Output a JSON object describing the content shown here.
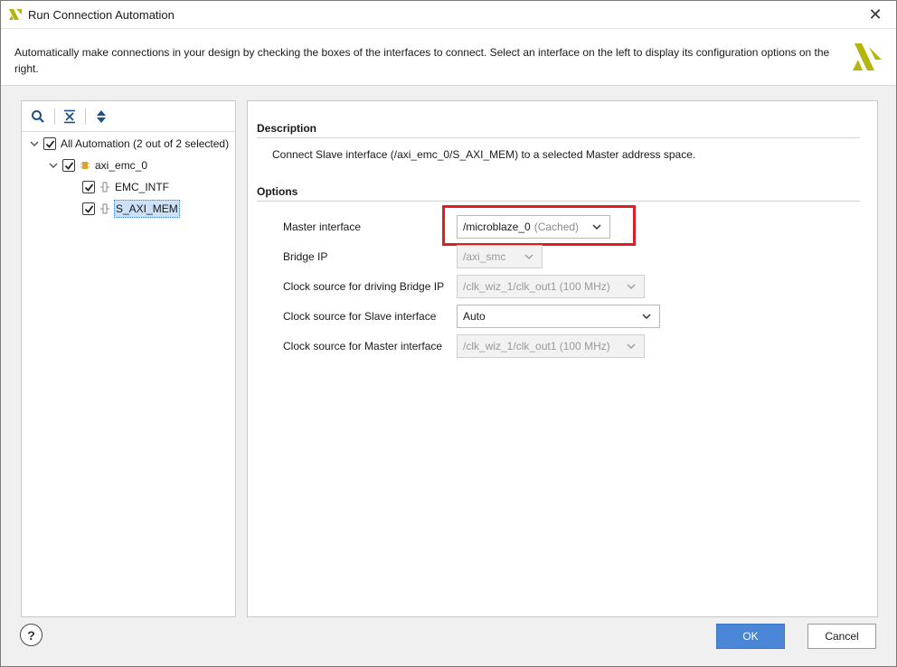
{
  "window": {
    "title": "Run Connection Automation",
    "close_glyph": "✕"
  },
  "header": {
    "description": "Automatically make connections in your design by checking the boxes of the interfaces to connect. Select an interface on the left to display its configuration options on the right."
  },
  "tree": {
    "toolbar": {
      "icons": [
        "search-icon",
        "collapse-all-icon",
        "expand-all-icon"
      ]
    },
    "items": [
      {
        "label": "All Automation (2 out of 2 selected)",
        "checked": true,
        "expanded": true,
        "level": 0
      },
      {
        "label": "axi_emc_0",
        "checked": true,
        "expanded": true,
        "level": 1,
        "icon": "ip-block-icon"
      },
      {
        "label": "EMC_INTF",
        "checked": true,
        "level": 2,
        "icon": "interface-icon"
      },
      {
        "label": "S_AXI_MEM",
        "checked": true,
        "level": 2,
        "icon": "interface-icon",
        "selected": true
      }
    ]
  },
  "details": {
    "description_title": "Description",
    "description_text": "Connect Slave interface (/axi_emc_0/S_AXI_MEM) to a selected Master address space.",
    "options_title": "Options",
    "options": [
      {
        "label": "Master interface",
        "value": "/microblaze_0",
        "suffix": "(Cached)",
        "enabled": true
      },
      {
        "label": "Bridge IP",
        "value": "/axi_smc",
        "enabled": false
      },
      {
        "label": "Clock source for driving Bridge IP",
        "value": "/clk_wiz_1/clk_out1 (100 MHz)",
        "enabled": false
      },
      {
        "label": "Clock source for Slave interface",
        "value": "Auto",
        "enabled": true
      },
      {
        "label": "Clock source for Master interface",
        "value": "/clk_wiz_1/clk_out1 (100 MHz)",
        "enabled": false
      }
    ]
  },
  "footer": {
    "help_label": "?",
    "ok_label": "OK",
    "cancel_label": "Cancel"
  },
  "colors": {
    "accent": "#4a86d6",
    "highlight": "#e31b23",
    "logo": "#b4b60c",
    "selection": "#cce0f7"
  }
}
